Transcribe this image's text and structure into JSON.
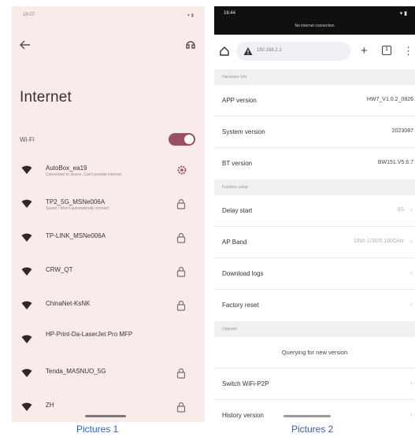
{
  "left_screen": {
    "status_time": "16:07",
    "status_icons": "▾ ▮",
    "title": "Internet",
    "wifi_label": "Wi-Fi",
    "wifi_enabled": true,
    "accent": "#9b4f63",
    "networks": [
      {
        "name": "AutoBox_ea19",
        "sub": "Connected to device. Can't provide internet.",
        "icon": "wifi-signal-icon",
        "trailing": "gear-icon"
      },
      {
        "name": "TP2_5G_MSNe006A",
        "sub": "Saved / Won't automatically connect",
        "icon": "wifi-signal-icon",
        "trailing": "lock-icon"
      },
      {
        "name": "TP-LINK_MSNe006A",
        "sub": "",
        "icon": "wifi-signal-icon",
        "trailing": "lock-icon"
      },
      {
        "name": "CRW_QT",
        "sub": "",
        "icon": "wifi-signal-icon",
        "trailing": "lock-icon"
      },
      {
        "name": "ChinaNet-KsNK",
        "sub": "",
        "icon": "wifi-signal-icon",
        "trailing": "lock-icon"
      },
      {
        "name": "HP-Print-Da-LaserJet Pro MFP",
        "sub": "",
        "icon": "wifi-signal-icon",
        "trailing": ""
      },
      {
        "name": "Tenda_MASNUO_5G",
        "sub": "",
        "icon": "wifi-signal-icon",
        "trailing": "lock-icon"
      },
      {
        "name": "ZH",
        "sub": "",
        "icon": "wifi-signal-icon",
        "trailing": "lock-icon"
      }
    ],
    "caption": "Pictures 1"
  },
  "right_screen": {
    "status_time": "16:44",
    "status_icons": "▾ ▮",
    "no_internet": "No internet connection",
    "url": "192.168.2.1",
    "tab_count": "1",
    "sections": {
      "hardware_info": "Hardware Info",
      "function_setup": "Function setup",
      "upgrade": "Upgrade"
    },
    "rows": {
      "app_version": {
        "label": "APP version",
        "value": "HW7_V1.0.2_0826"
      },
      "system_version": {
        "label": "System version",
        "value": "2023087"
      },
      "bt_version": {
        "label": "BT version",
        "value": "BW151.V5.6.7"
      },
      "delay_start": {
        "label": "Delay start",
        "value": "0S"
      },
      "ap_band": {
        "label": "AP Band",
        "value": "UNII-1/36/5.180GHz"
      },
      "download_logs": {
        "label": "Download logs"
      },
      "factory_reset": {
        "label": "Factory reset"
      },
      "querying": {
        "label": "Querying for new version"
      },
      "switch_wifi_p2p": {
        "label": "Switch WiFi-P2P"
      },
      "history_version": {
        "label": "History version"
      }
    },
    "caption": "Pictures 2"
  }
}
